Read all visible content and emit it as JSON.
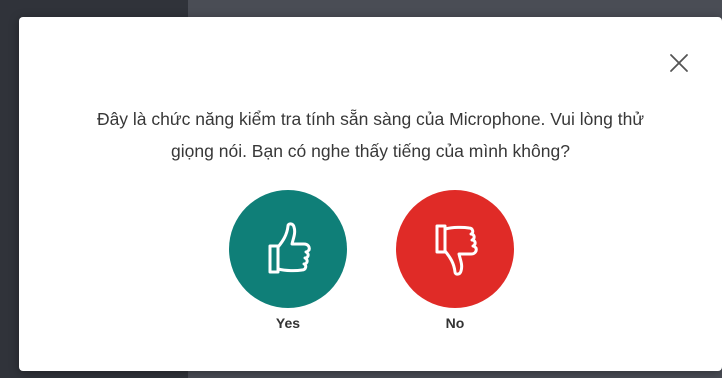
{
  "dialog": {
    "message_line1": "Đây là chức năng kiểm tra tính sẵn sàng của Microphone. Vui lòng thử",
    "message_line2": "giọng nói. Bạn có nghe thấy tiếng của mình không?",
    "close_icon": "close-icon",
    "yes": {
      "label": "Yes",
      "icon": "thumbs-up-icon",
      "color": "#0f7f78"
    },
    "no": {
      "label": "No",
      "icon": "thumbs-down-icon",
      "color": "#e02b27"
    }
  }
}
